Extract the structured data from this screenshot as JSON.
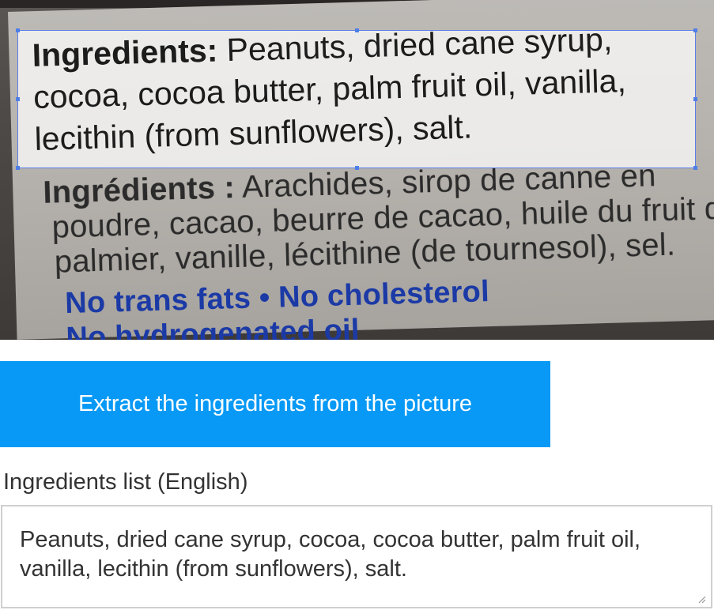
{
  "photo": {
    "crop_text": {
      "line1_bold": "Ingredients:",
      "line1_rest": " Peanuts, dried cane syrup,",
      "line2": "cocoa, cocoa butter, palm fruit oil, vanilla,",
      "line3": "lecithin (from sunflowers), salt."
    },
    "french_text": {
      "line1_bold": "Ingrédients :",
      "line1_rest": "  Arachides, sirop de canne en",
      "line2": "poudre, cacao, beurre de cacao, huile du fruit d",
      "line3": "palmier, vanille, lécithine (de tournesol), sel."
    },
    "claims": {
      "line1": "No trans fats • No cholesterol",
      "line2": "No hydrogenated oil"
    }
  },
  "extract_button": {
    "label": "Extract the ingredients from the picture"
  },
  "ingredients_field": {
    "label": "Ingredients list (English)",
    "value": "Peanuts, dried cane syrup, cocoa, cocoa butter, palm fruit oil, vanilla, lecithin (from sunflowers), salt."
  },
  "colors": {
    "button_bg": "#0799f5",
    "crop_border": "#5b7fe8"
  }
}
